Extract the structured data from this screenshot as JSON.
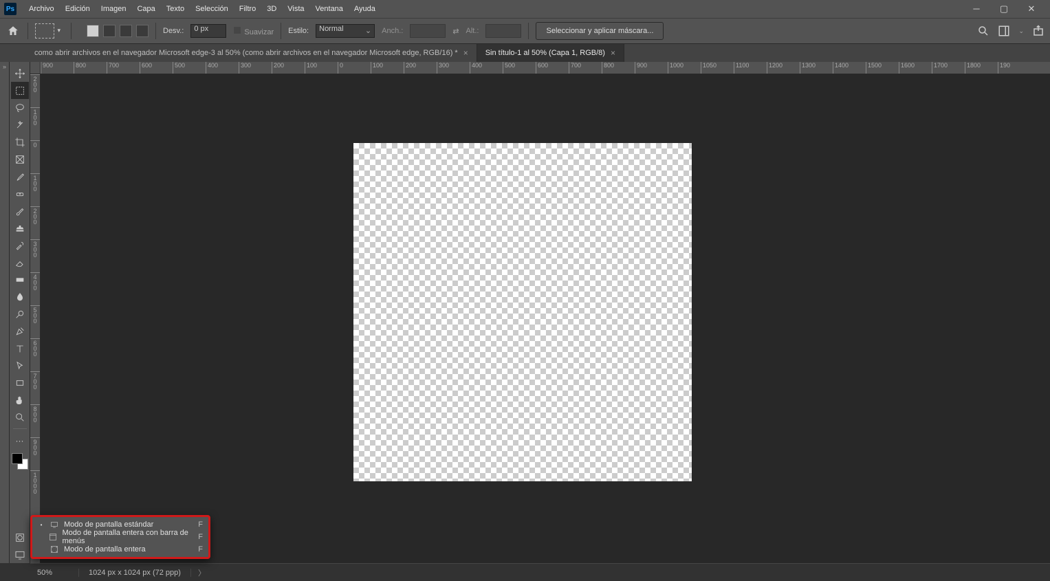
{
  "menu": {
    "items": [
      "Archivo",
      "Edición",
      "Imagen",
      "Capa",
      "Texto",
      "Selección",
      "Filtro",
      "3D",
      "Vista",
      "Ventana",
      "Ayuda"
    ]
  },
  "options": {
    "desv_label": "Desv.:",
    "desv_value": "0 px",
    "suavizar": "Suavizar",
    "estilo_label": "Estilo:",
    "estilo_value": "Normal",
    "anch_label": "Anch.:",
    "alt_label": "Alt.:",
    "mask_button": "Seleccionar y aplicar máscara..."
  },
  "tabs": [
    {
      "label": "como abrir archivos en el navegador Microsoft edge-3 al 50% (como abrir archivos en el navegador Microsoft edge, RGB/16) *",
      "active": false
    },
    {
      "label": "Sin título-1 al 50% (Capa 1, RGB/8)",
      "active": true
    }
  ],
  "ruler_h": [
    "900",
    "800",
    "700",
    "600",
    "500",
    "400",
    "300",
    "200",
    "100",
    "0",
    "100",
    "200",
    "300",
    "400",
    "500",
    "600",
    "700",
    "800",
    "900",
    "1000",
    "1050",
    "1100",
    "1200",
    "1300",
    "1400",
    "1500",
    "1600",
    "1700",
    "1800",
    "190"
  ],
  "ruler_v": [
    "2 0 0",
    "1 0 0",
    "0",
    "1 0 0",
    "2 0 0",
    "3 0 0",
    "4 0 0",
    "5 0 0",
    "6 0 0",
    "7 0 0",
    "8 0 0",
    "9 0 0",
    "1 0 0 0"
  ],
  "status": {
    "zoom": "50%",
    "docinfo": "1024 px x 1024 px (72 ppp)"
  },
  "flyout": {
    "items": [
      {
        "selected": true,
        "label": "Modo de pantalla estándar",
        "shortcut": "F"
      },
      {
        "selected": false,
        "label": "Modo de pantalla entera con barra de menús",
        "shortcut": "F"
      },
      {
        "selected": false,
        "label": "Modo de pantalla entera",
        "shortcut": "F"
      }
    ]
  }
}
